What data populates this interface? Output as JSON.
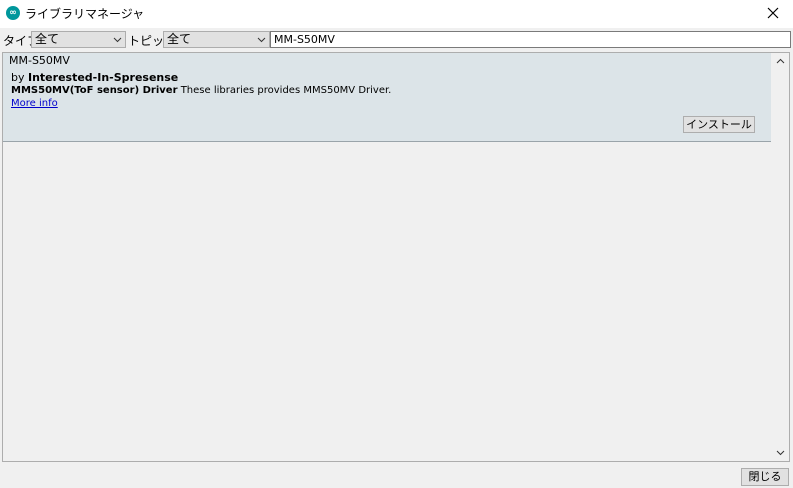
{
  "window": {
    "title": "ライブラリマネージャ",
    "app_icon": "arduino-icon",
    "close_icon": "close-icon"
  },
  "filters": {
    "type_label": "タイプ",
    "type_value": "全て",
    "topic_label": "トピック",
    "topic_value": "全て",
    "search_value": "MM-S50MV"
  },
  "library": {
    "name": "MM-S50MV",
    "by_prefix": "by ",
    "author": "Interested-In-Spresense",
    "sentence": "MMS50MV(ToF sensor) Driver",
    "paragraph": " These libraries provides MMS50MV Driver.",
    "more_info": "More info",
    "install_label": "インストール"
  },
  "footer": {
    "close_label": "閉じる"
  },
  "colors": {
    "item_background": "#dce4e8",
    "link": "#0000cc",
    "window_background": "#f0f0f0"
  }
}
